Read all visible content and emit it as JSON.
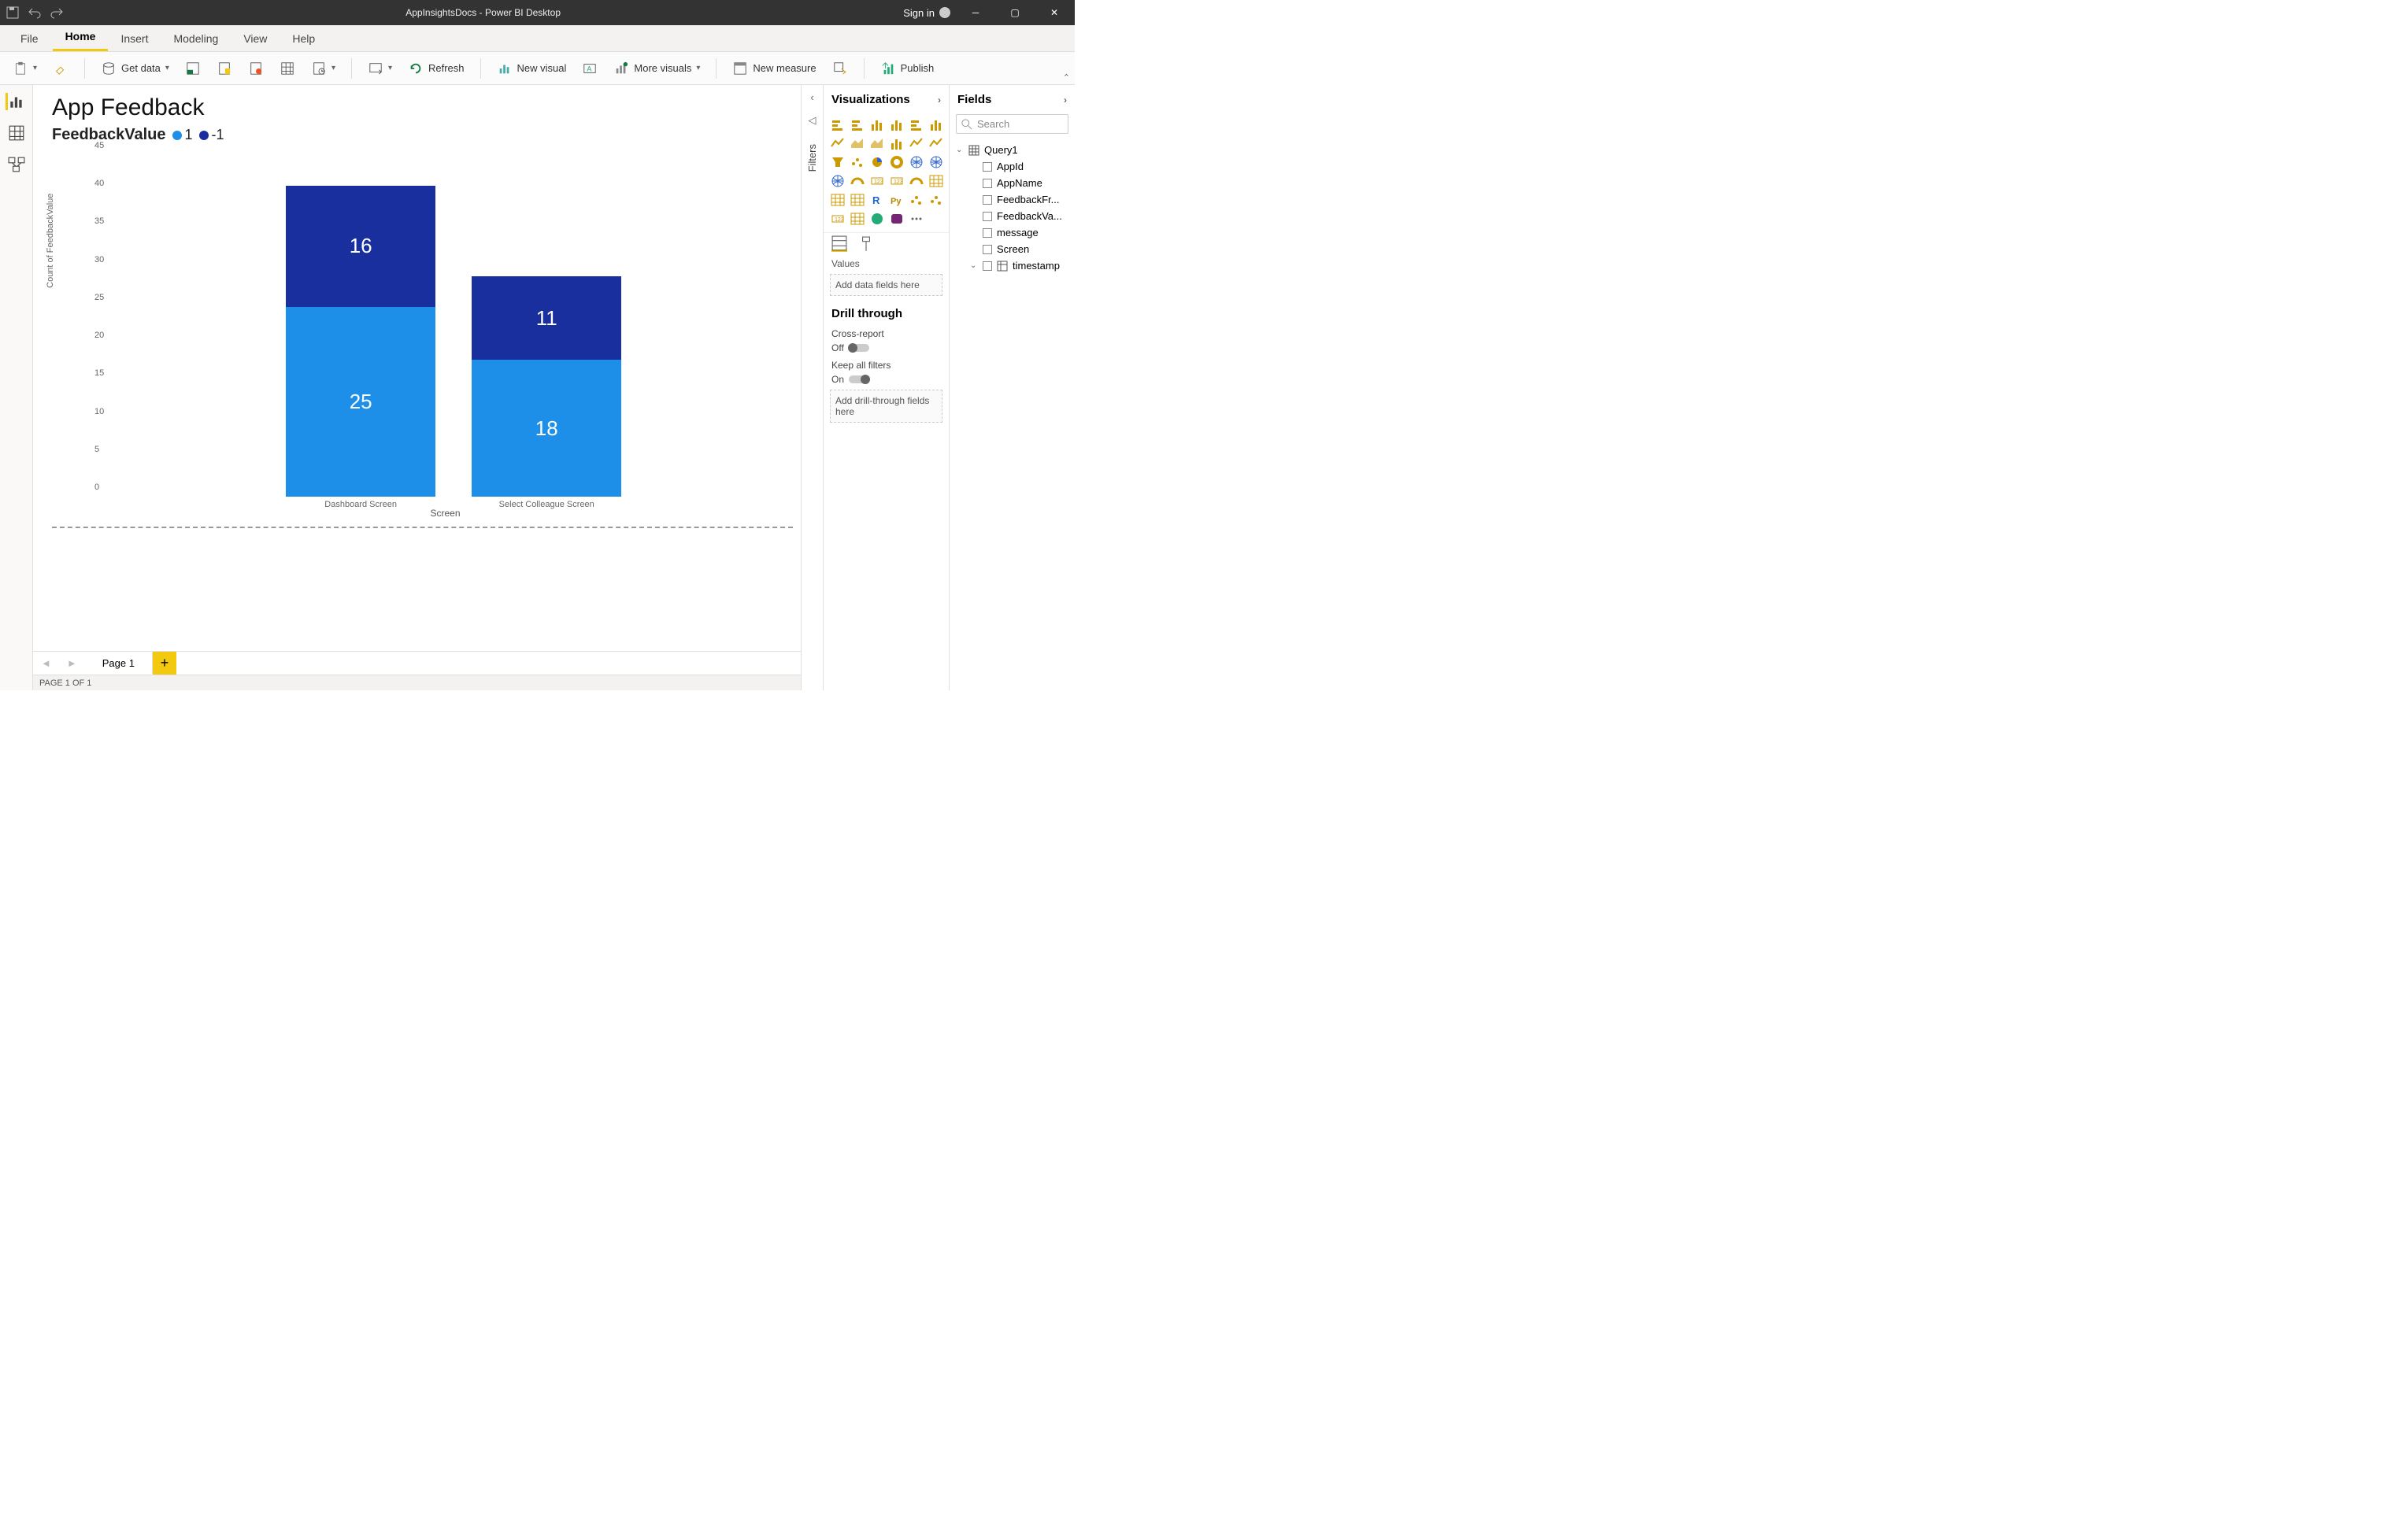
{
  "titlebar": {
    "title": "AppInsightsDocs - Power BI Desktop",
    "signin": "Sign in"
  },
  "ribbon_tabs": [
    "File",
    "Home",
    "Insert",
    "Modeling",
    "View",
    "Help"
  ],
  "active_tab": "Home",
  "ribbon": {
    "get_data": "Get data",
    "refresh": "Refresh",
    "new_visual": "New visual",
    "more_visuals": "More visuals",
    "new_measure": "New measure",
    "publish": "Publish"
  },
  "report": {
    "title": "App Feedback",
    "legend_label": "FeedbackValue",
    "legend_items": [
      {
        "label": "1",
        "color": "#1e8fe8"
      },
      {
        "label": "-1",
        "color": "#1a2f9e"
      }
    ]
  },
  "chart_data": {
    "type": "bar",
    "stacked": true,
    "title": "App Feedback",
    "xlabel": "Screen",
    "ylabel": "Count of FeedbackValue",
    "categories": [
      "Dashboard Screen",
      "Select Colleague Screen"
    ],
    "series": [
      {
        "name": "1",
        "color": "#1e8fe8",
        "values": [
          25,
          18
        ]
      },
      {
        "name": "-1",
        "color": "#1a2f9e",
        "values": [
          16,
          11
        ]
      }
    ],
    "ylim": [
      0,
      45
    ],
    "yticks": [
      0,
      5,
      10,
      15,
      20,
      25,
      30,
      35,
      40,
      45
    ]
  },
  "page_tabs": {
    "page1": "Page 1"
  },
  "statusbar": {
    "text": "PAGE 1 OF 1"
  },
  "vis_pane": {
    "title": "Visualizations",
    "values_label": "Values",
    "values_well": "Add data fields here",
    "drill_header": "Drill through",
    "cross_report": "Cross-report",
    "cross_state": "Off",
    "keep_filters": "Keep all filters",
    "keep_state": "On",
    "drill_well": "Add drill-through fields here"
  },
  "fields_pane": {
    "title": "Fields",
    "search_placeholder": "Search",
    "table": "Query1",
    "columns": [
      "AppId",
      "AppName",
      "FeedbackFr...",
      "FeedbackVa...",
      "message",
      "Screen",
      "timestamp"
    ]
  },
  "filters_label": "Filters"
}
